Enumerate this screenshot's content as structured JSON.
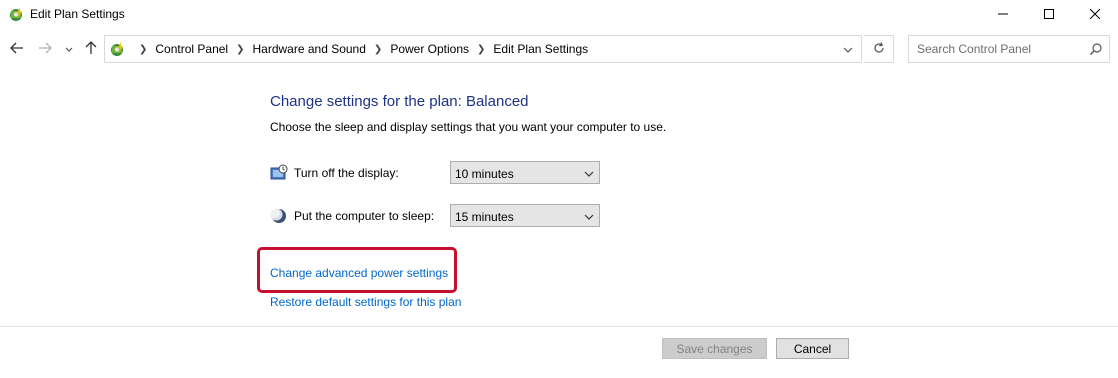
{
  "window": {
    "title": "Edit Plan Settings",
    "icon": "power-options-icon",
    "controls": [
      "minimize-icon",
      "maximize-icon",
      "close-icon"
    ]
  },
  "navigation": {
    "breadcrumbs": [
      "Control Panel",
      "Hardware and Sound",
      "Power Options",
      "Edit Plan Settings"
    ],
    "search_placeholder": "Search Control Panel"
  },
  "content": {
    "heading": "Change settings for the plan: Balanced",
    "description": "Choose the sleep and display settings that you want your computer to use.",
    "settings": [
      {
        "label": "Turn off the display:",
        "value": "10 minutes",
        "icon": "display-icon"
      },
      {
        "label": "Put the computer to sleep:",
        "value": "15 minutes",
        "icon": "sleep-moon-icon"
      }
    ],
    "links": {
      "advanced": "Change advanced power settings",
      "restore": "Restore default settings for this plan"
    }
  },
  "footer": {
    "save_label": "Save changes",
    "cancel_label": "Cancel"
  },
  "colors": {
    "heading": "#1e3287",
    "link": "#0066cc",
    "highlight": "#c8102e"
  }
}
